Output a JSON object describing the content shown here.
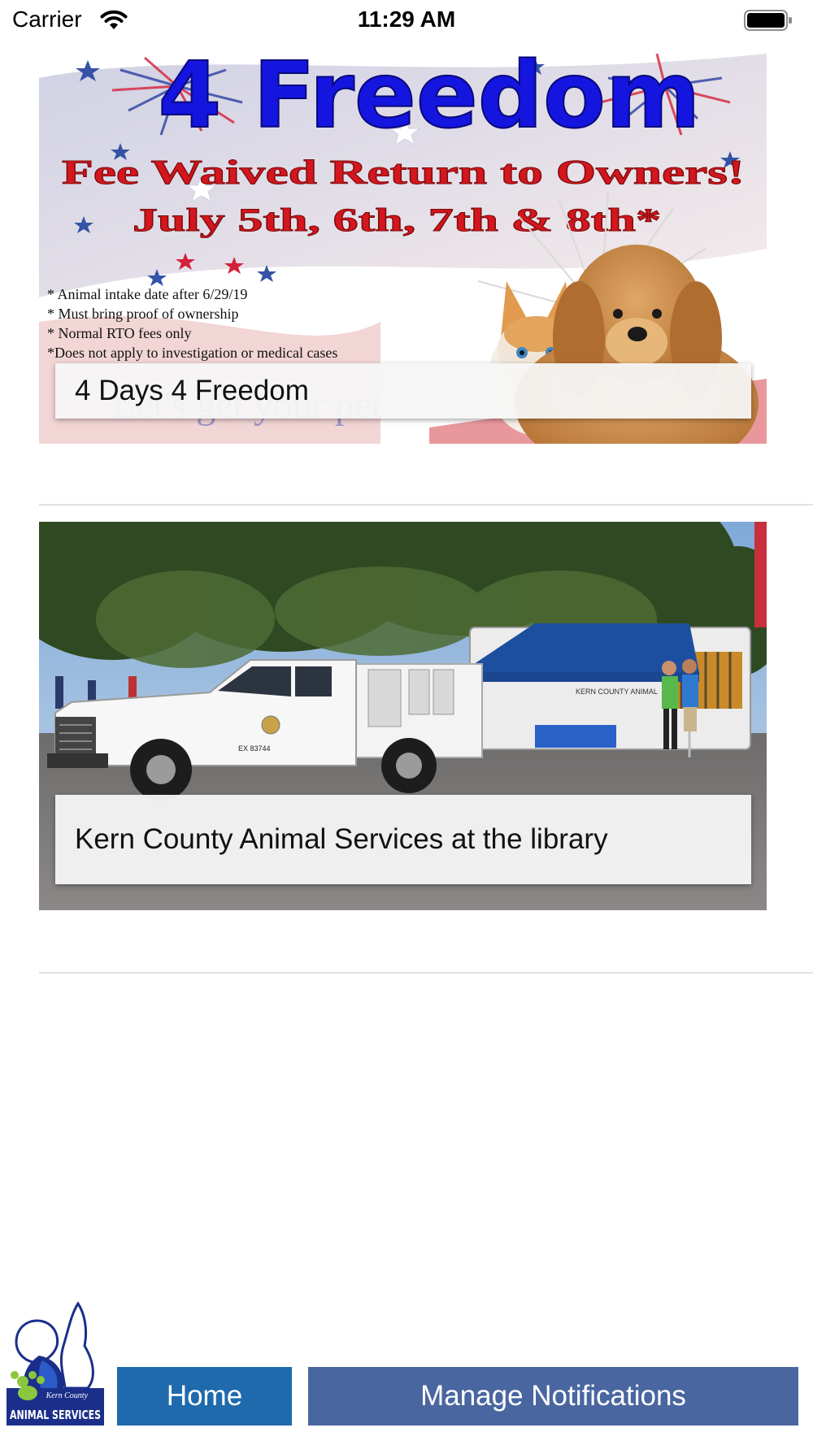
{
  "status_bar": {
    "carrier": "Carrier",
    "time": "11:29 AM"
  },
  "news": [
    {
      "caption": "4 Days 4 Freedom",
      "flyer": {
        "headline": "4 Freedom",
        "subhead": "Fee Waived Return to Owners!",
        "dates": "July 5th, 6th, 7th & 8th*",
        "notes": [
          "* Animal intake date after 6/29/19",
          "* Must bring proof of ownership",
          "* Normal RTO fees only",
          "*Does not apply to investigation or medical cases"
        ],
        "footer_text": "Let's get your pet"
      }
    },
    {
      "caption": "Kern County Animal Services at the library",
      "photo": {
        "tent_label": "KERN COUNTY ANIMAL",
        "plate": "EX 83744"
      }
    }
  ],
  "logo": {
    "line1": "Kern County",
    "line2": "ANIMAL SERVICES"
  },
  "nav": {
    "home": "Home",
    "manage_notifications": "Manage Notifications"
  },
  "colors": {
    "home_button": "#1f6aad",
    "notifications_button": "#4a66a0",
    "divider": "#e2e2e2"
  }
}
